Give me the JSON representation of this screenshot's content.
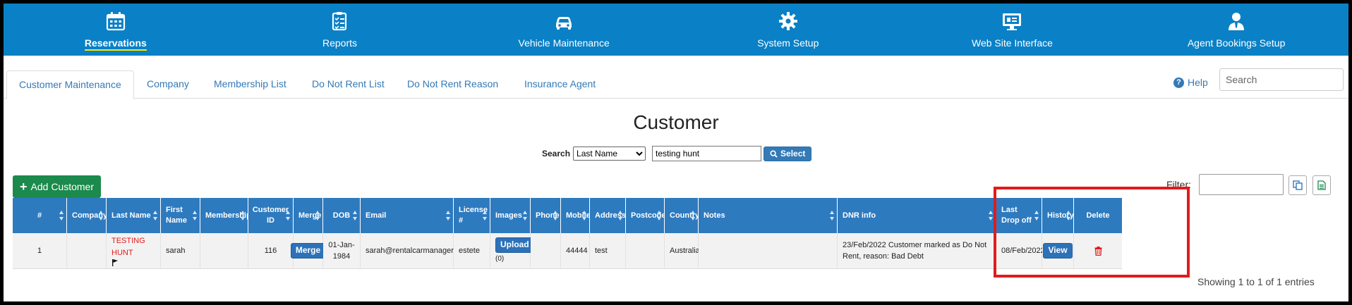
{
  "nav": {
    "items": [
      {
        "label": "Reservations",
        "icon": "calendar-icon",
        "active": true
      },
      {
        "label": "Reports",
        "icon": "checklist-icon"
      },
      {
        "label": "Vehicle Maintenance",
        "icon": "car-icon"
      },
      {
        "label": "System Setup",
        "icon": "gear-icon"
      },
      {
        "label": "Web Site Interface",
        "icon": "monitor-icon"
      },
      {
        "label": "Agent Bookings Setup",
        "icon": "agent-icon"
      }
    ]
  },
  "tabs": {
    "items": [
      {
        "label": "Customer Maintenance",
        "active": true
      },
      {
        "label": "Company"
      },
      {
        "label": "Membership List"
      },
      {
        "label": "Do Not Rent List"
      },
      {
        "label": "Do Not Rent Reason"
      },
      {
        "label": "Insurance Agent"
      }
    ],
    "help_label": "Help",
    "search_placeholder": "Search"
  },
  "page": {
    "title": "Customer"
  },
  "search": {
    "label": "Search",
    "field_selected": "Last Name",
    "value": "testing hunt",
    "button_label": "Select"
  },
  "toolbar": {
    "add_label": "Add Customer",
    "filter_label": "Filter:"
  },
  "table": {
    "headers": {
      "num": "#",
      "company": "Company",
      "last_name": "Last Name",
      "first_name": "First Name",
      "membership": "Membership",
      "customer_id": "Customer ID",
      "merge": "Merge",
      "dob": "DOB",
      "email": "Email",
      "license": "License #",
      "images": "Images",
      "phone": "Phone",
      "mobile": "Mobile",
      "address": "Address",
      "postcode": "Postcode",
      "country": "Country",
      "notes": "Notes",
      "dnr_info": "DNR info",
      "last_drop_off": "Last Drop off",
      "history": "History",
      "delete": "Delete"
    },
    "rows": [
      {
        "num": "1",
        "company": "",
        "last_name": "TESTING HUNT",
        "first_name": "sarah",
        "membership": "",
        "customer_id": "116",
        "merge_label": "Merge",
        "dob": "01-Jan-1984",
        "email": "sarah@rentalcarmanager.com",
        "license": "estete",
        "upload_label": "Upload",
        "images_count": "(0)",
        "phone": "",
        "mobile": "44444",
        "address": "test",
        "postcode": "",
        "country": "Australia",
        "notes": "",
        "dnr_info": "23/Feb/2022 Customer marked as Do Not Rent, reason: Bad Debt",
        "last_drop_off": "08/Feb/2022",
        "view_label": "View"
      }
    ],
    "info": "Showing 1 to 1 of 1 entries"
  },
  "colors": {
    "nav_bg": "#0a80c6",
    "header_bg": "#2e7abf",
    "add_button": "#1b8a4c",
    "highlight": "#e21b1b",
    "active_underline": "#f6e90d"
  }
}
